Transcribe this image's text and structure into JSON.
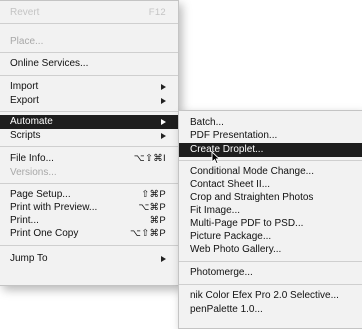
{
  "file_menu": {
    "items": [
      {
        "label": "Revert",
        "shortcut": "F12",
        "disabled": true
      },
      {
        "label": "Place...",
        "disabled": true
      },
      {
        "label": "Online Services..."
      },
      {
        "label": "Import"
      },
      {
        "label": "Export"
      },
      {
        "label": "Automate"
      },
      {
        "label": "Scripts"
      },
      {
        "label": "File Info...",
        "shortcut": "⌥⇧⌘I"
      },
      {
        "label": "Versions...",
        "disabled": true
      },
      {
        "label": "Page Setup...",
        "shortcut": "⇧⌘P"
      },
      {
        "label": "Print with Preview...",
        "shortcut": "⌥⌘P"
      },
      {
        "label": "Print...",
        "shortcut": "⌘P"
      },
      {
        "label": "Print One Copy",
        "shortcut": "⌥⇧⌘P"
      },
      {
        "label": "Jump To"
      }
    ]
  },
  "automate_menu": {
    "items": [
      {
        "label": "Batch..."
      },
      {
        "label": "PDF Presentation..."
      },
      {
        "label": "Create Droplet...",
        "highlighted": true
      },
      {
        "label": "Conditional Mode Change..."
      },
      {
        "label": "Contact Sheet II..."
      },
      {
        "label": "Crop and Straighten Photos"
      },
      {
        "label": "Fit Image..."
      },
      {
        "label": "Multi-Page PDF to PSD..."
      },
      {
        "label": "Picture Package..."
      },
      {
        "label": "Web Photo Gallery..."
      },
      {
        "label": "Photomerge..."
      },
      {
        "label": "nik Color Efex Pro 2.0 Selective..."
      },
      {
        "label": "penPalette 1.0..."
      }
    ]
  },
  "colors": {
    "highlight": "#1e1e1e",
    "menu_bg": "#f2f2f2",
    "disabled": "#a8a8a8"
  }
}
